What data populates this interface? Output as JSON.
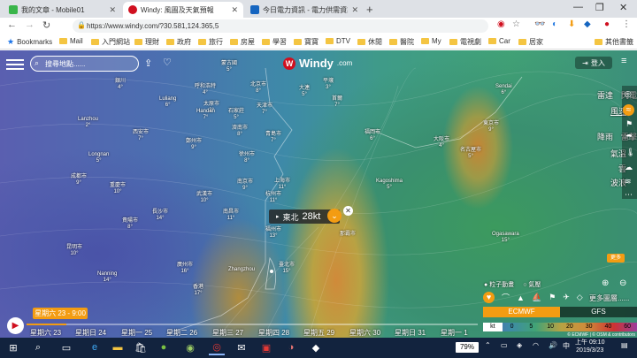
{
  "browser": {
    "tabs": [
      {
        "label": "我的文章 - Mobile01",
        "color": "#39b54a"
      },
      {
        "label": "Windy: 風圖及天氣預報",
        "color": "#d0101f"
      },
      {
        "label": "今日電力資訊 - 電力供需資訊 - 台",
        "color": "#1565c0"
      }
    ],
    "new_tab": "+",
    "url": "https://www.windy.com/?30.581,124.365,5",
    "bookmarks_label": "Bookmarks",
    "bookmarks": [
      "Mail",
      "入門網站",
      "理財",
      "政府",
      "旅行",
      "房屋",
      "學習",
      "寶寶",
      "DTV",
      "休閒",
      "醫院",
      "My",
      "電視劇",
      "Car",
      "居家"
    ],
    "other_bookmarks": "其他書籤"
  },
  "windy": {
    "search_placeholder": "搜尋地點......",
    "logo": "Windy",
    "logo_suffix": ".com",
    "login": "登入",
    "picker_dir": "東北",
    "picker_value": "28kt",
    "overlays": [
      {
        "label": "雷達",
        "extra": "閃電"
      },
      {
        "label": "風速"
      },
      {
        "label": "降雨",
        "extra": "雷擊"
      },
      {
        "label": "氣溫"
      },
      {
        "label": "雲"
      },
      {
        "label": "波浪"
      }
    ],
    "layers_btn": "更多",
    "particles": "粒子動畫",
    "isolines": "氣壓",
    "more_layers": "更多圖層......",
    "models": [
      "ECMWF",
      "GFS"
    ],
    "legend_unit": "kt",
    "legend": [
      "0",
      "5",
      "10",
      "20",
      "30",
      "40",
      "60"
    ],
    "time_bubble": "星期六 23 - 9:00",
    "days": [
      "星期六 23",
      "星期日 24",
      "星期一 25",
      "星期二 26",
      "星期三 27",
      "星期四 28",
      "星期五 29",
      "星期六 30",
      "星期日 31",
      "星期一 1"
    ],
    "copyright": "© ECMWF | © OSM & contributors"
  },
  "map_labels": [
    {
      "t": "蒙古國\n5°"
    },
    {
      "t": "呼和浩特\n4°"
    },
    {
      "t": "北京市\n8°"
    },
    {
      "t": "大連\n5°"
    },
    {
      "t": "平壤\n3°"
    },
    {
      "t": "首爾\n7°"
    },
    {
      "t": "Sendai\n6°"
    },
    {
      "t": "銀川\n4°"
    },
    {
      "t": "太原市\n2°"
    },
    {
      "t": "石家莊\n5°"
    },
    {
      "t": "天津市\n7°"
    },
    {
      "t": "Lanzhou\n2°"
    },
    {
      "t": "西安市\n7°"
    },
    {
      "t": "Luliang\n6°"
    },
    {
      "t": "Handan\n7°"
    },
    {
      "t": "濟南市\n8°"
    },
    {
      "t": "青島市\n7°"
    },
    {
      "t": "鄭州市\n9°"
    },
    {
      "t": "徐州市\n8°"
    },
    {
      "t": "福岡市\n6°"
    },
    {
      "t": "大阪市\n4°"
    },
    {
      "t": "東京市\n9°"
    },
    {
      "t": "名古屋市\n5°"
    },
    {
      "t": "Longnan\n5°"
    },
    {
      "t": "成都市\n9°"
    },
    {
      "t": "重慶市\n10°"
    },
    {
      "t": "武漢市\n10°"
    },
    {
      "t": "南京市\n9°"
    },
    {
      "t": "上海市\n11°"
    },
    {
      "t": "杭州市\n11°"
    },
    {
      "t": "Kagoshima\n5°"
    },
    {
      "t": "長沙市\n14°"
    },
    {
      "t": "南昌市\n11°"
    },
    {
      "t": "福州市\n13°"
    },
    {
      "t": "貴陽市\n8°"
    },
    {
      "t": "昆明市\n10°"
    },
    {
      "t": "Zhangzhou"
    },
    {
      "t": "廣州市\n16°"
    },
    {
      "t": "臺北市\n15°"
    },
    {
      "t": "香港\n17°"
    },
    {
      "t": "那霸市"
    },
    {
      "t": "Ogasawara\n15°"
    },
    {
      "t": "Nanning\n14°"
    }
  ],
  "taskbar": {
    "search_icon": "search-icon",
    "battery": "79%",
    "time": "上午 09:10",
    "date": "2019/3/23"
  }
}
